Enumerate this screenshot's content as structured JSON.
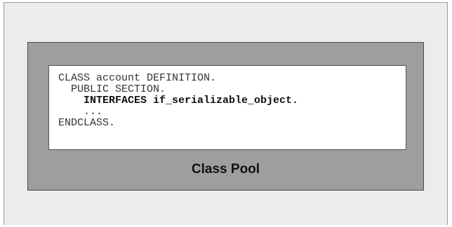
{
  "code": {
    "lines": [
      {
        "text": "CLASS account DEFINITION.",
        "bold": false
      },
      {
        "text": "  PUBLIC SECTION.",
        "bold": false
      },
      {
        "text": "    INTERFACES if_serializable_object.",
        "bold": true
      },
      {
        "text": "    ...",
        "bold": false
      },
      {
        "text": "ENDCLASS.",
        "bold": false
      }
    ]
  },
  "pool": {
    "label": "Class Pool"
  }
}
